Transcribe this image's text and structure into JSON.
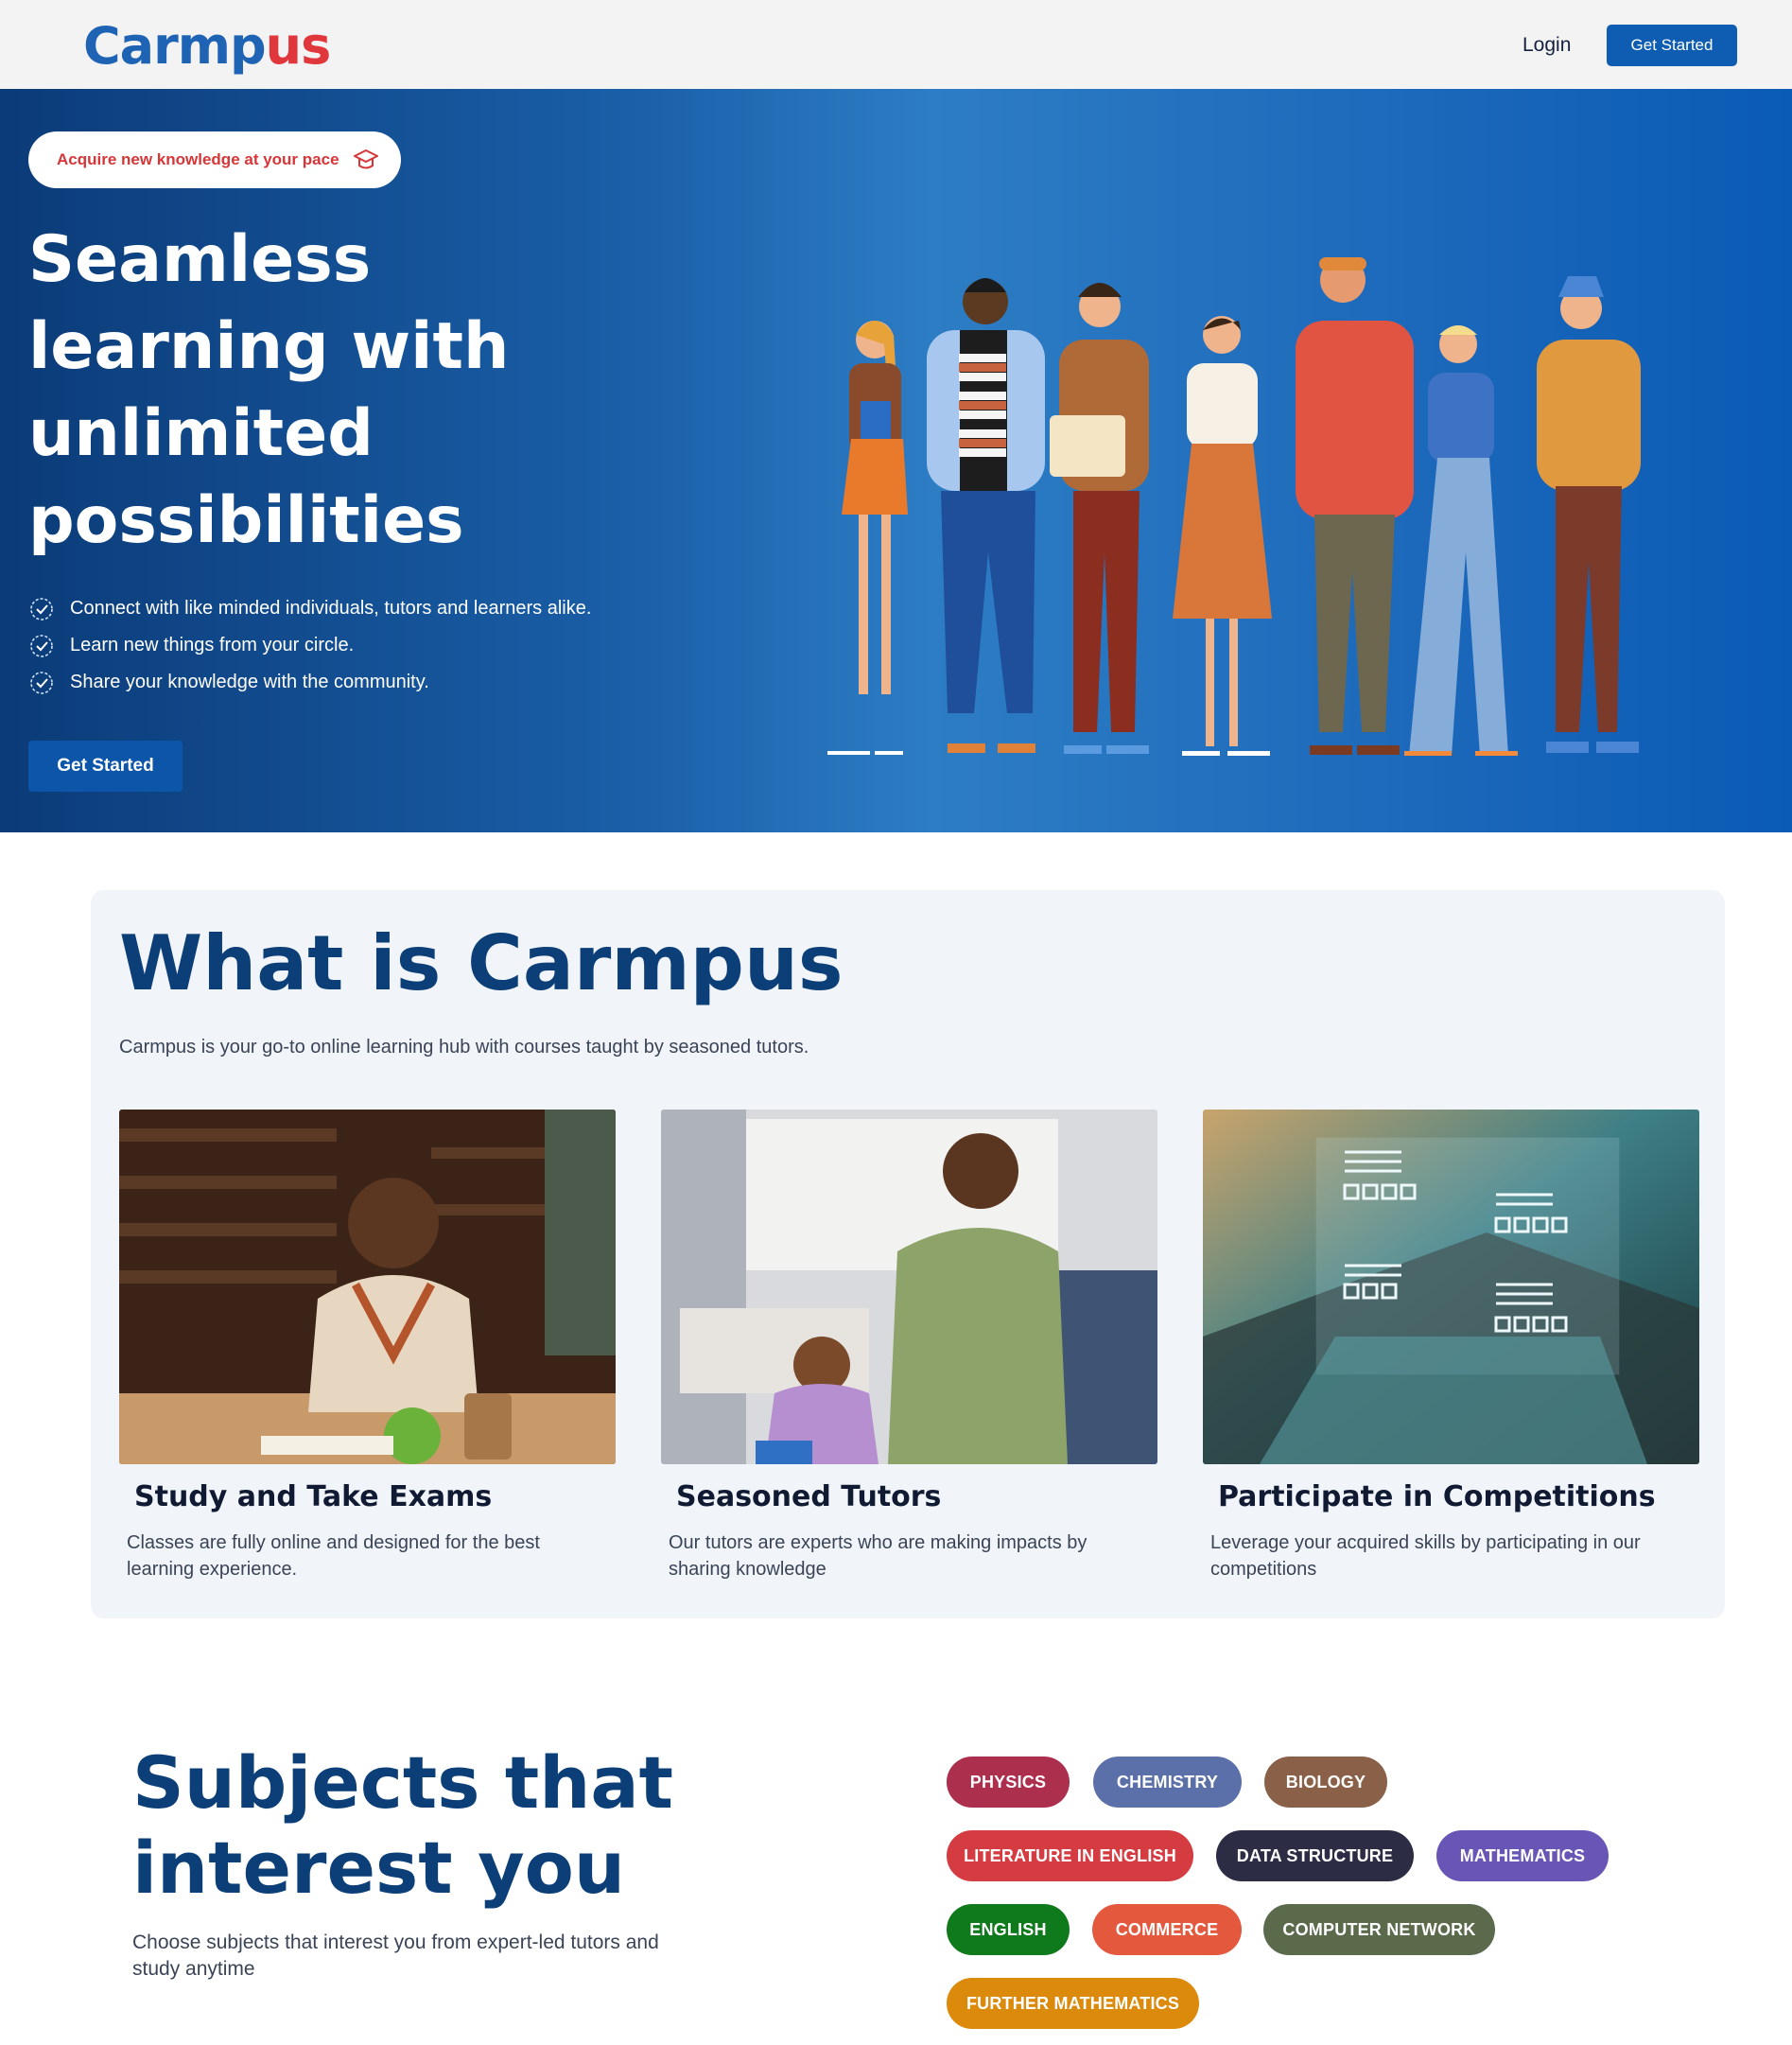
{
  "nav": {
    "logo_part1": "Carmp",
    "logo_part2": "us",
    "login": "Login",
    "get_started": "Get Started"
  },
  "hero": {
    "tagline": "Acquire new knowledge at your pace",
    "title": "Seamless learning with unlimited possibilities",
    "bullets": [
      "Connect with like minded individuals, tutors and learners alike.",
      "Learn new things from your circle.",
      "Share your knowledge with the community."
    ],
    "cta": "Get Started"
  },
  "what": {
    "title": "What is Carmpus",
    "intro": "Carmpus is your go-to online learning hub with courses taught by seasoned tutors.",
    "cards": [
      {
        "title": "Study and Take Exams",
        "text": "Classes are fully online and designed for the best learning experience."
      },
      {
        "title": "Seasoned Tutors",
        "text": "Our tutors are experts who are making impacts by sharing knowledge"
      },
      {
        "title": "Participate in Competitions",
        "text": "Leverage your acquired skills by participating in our competitions"
      }
    ]
  },
  "subjects": {
    "title": "Subjects that interest you",
    "subtitle": "Choose subjects that interest you from expert-led tutors and study anytime",
    "chips": [
      {
        "label": "PHYSICS",
        "color": "#ad2f4e"
      },
      {
        "label": "CHEMISTRY",
        "color": "#5b70a8"
      },
      {
        "label": "BIOLOGY",
        "color": "#8a6148"
      },
      {
        "label": "LITERATURE IN ENGLISH",
        "color": "#d43c41"
      },
      {
        "label": "DATA STRUCTURE",
        "color": "#2c2d45"
      },
      {
        "label": "MATHEMATICS",
        "color": "#6955b5"
      },
      {
        "label": "ENGLISH",
        "color": "#0f7a1b"
      },
      {
        "label": "COMMERCE",
        "color": "#e4583d"
      },
      {
        "label": "COMPUTER NETWORK",
        "color": "#5a6a4b"
      },
      {
        "label": "FURTHER MATHEMATICS",
        "color": "#db8a0c"
      }
    ]
  },
  "colors": {
    "brand_blue": "#1f63b5",
    "brand_red": "#e0373c",
    "heading_navy": "#0c3f78"
  },
  "icons": [
    "graduation-cap-icon",
    "check-badge-icon"
  ]
}
